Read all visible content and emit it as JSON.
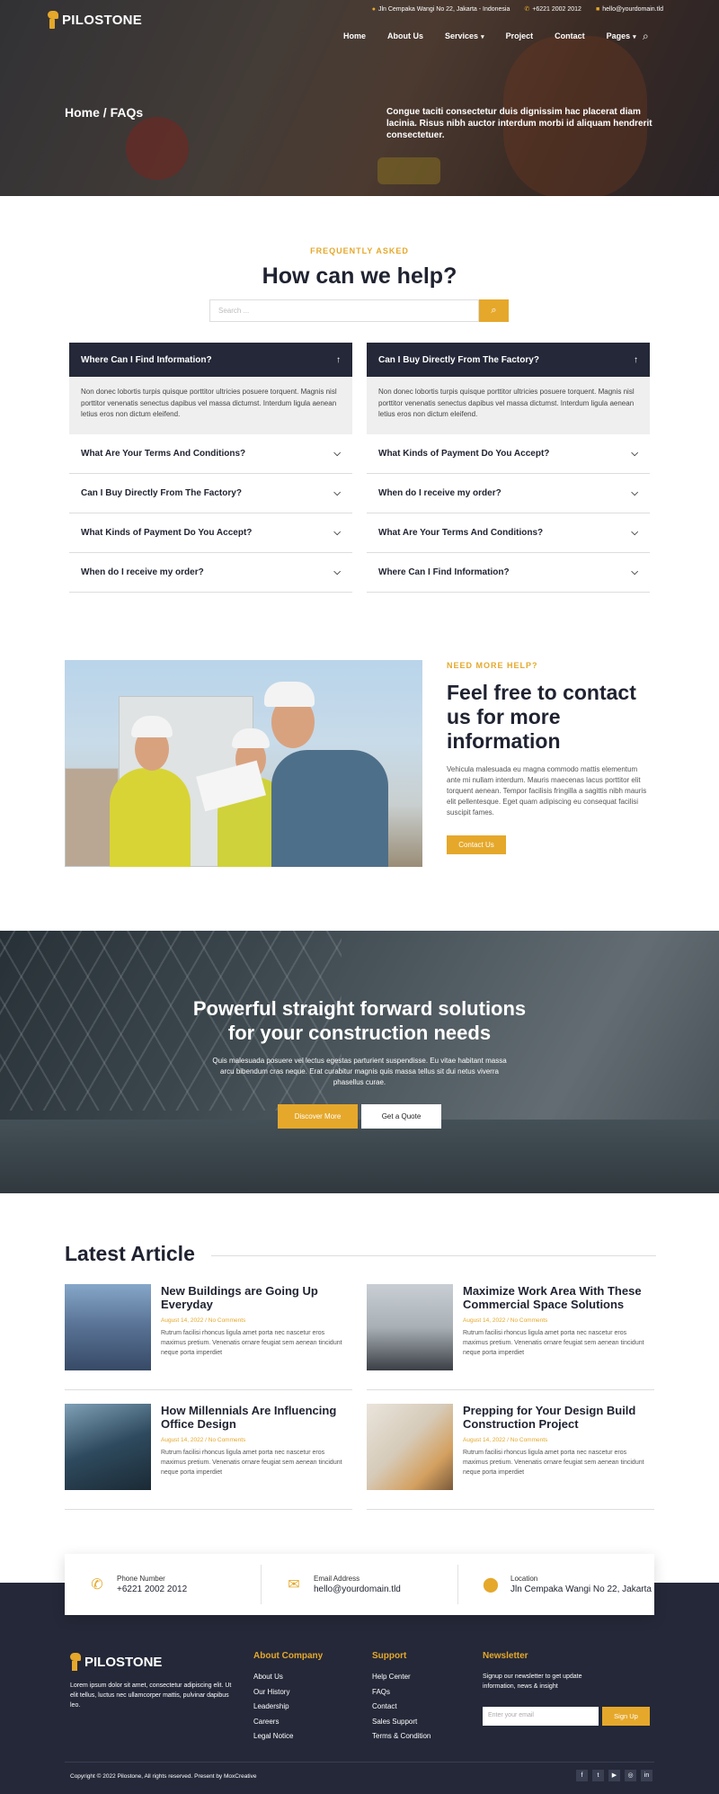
{
  "topbar": {
    "address": "Jln Cempaka Wangi No 22, Jakarta - Indonesia",
    "phone": "+6221 2002 2012",
    "email": "hello@yourdomain.tld"
  },
  "brand": {
    "name": "PILOSTONE"
  },
  "nav": [
    "Home",
    "About Us",
    "Services",
    "Project",
    "Contact",
    "Pages"
  ],
  "hero": {
    "breadcrumb": "Home / FAQs",
    "text": "Congue taciti consectetur duis dignissim hac placerat diam lacinia. Risus nibh auctor interdum morbi id aliquam hendrerit consectetuer."
  },
  "faq": {
    "eyebrow": "FREQUENTLY ASKED",
    "title": "How can we help?",
    "search_placeholder": "Search ...",
    "left": {
      "open_q": "Where Can I Find Information?",
      "answer": "Non donec lobortis turpis quisque porttitor ultricies posuere torquent. Magnis nisl porttitor venenatis senectus dapibus vel massa dictumst. Interdum ligula aenean letius eros non dictum eleifend.",
      "items": [
        "What Are Your Terms And Conditions?",
        "Can I Buy Directly From The Factory?",
        "What Kinds of Payment Do You Accept?",
        "When do I receive my order?"
      ]
    },
    "right": {
      "open_q": "Can I Buy Directly From The Factory?",
      "answer": "Non donec lobortis turpis quisque porttitor ultricies posuere torquent. Magnis nisl porttitor venenatis senectus dapibus vel massa dictumst. Interdum ligula aenean letius eros non dictum eleifend.",
      "items": [
        "What Kinds of Payment Do You Accept?",
        "When do I receive my order?",
        "What Are Your Terms And Conditions?",
        "Where Can I Find Information?"
      ]
    }
  },
  "contact": {
    "eyebrow": "NEED MORE HELP?",
    "title": "Feel free to contact us for more information",
    "text": "Vehicula malesuada eu magna commodo mattis elementum ante mi nullam interdum. Mauris maecenas lacus porttitor elit torquent aenean. Tempor facilisis fringilla a sagittis nibh mauris elit pellentesque. Eget quam adipiscing eu consequat facilisi suscipit fames.",
    "button": "Contact Us"
  },
  "cta": {
    "title_l1": "Powerful straight forward solutions",
    "title_l2": "for your construction needs",
    "text": "Quis malesuada posuere vel lectus egestas parturient suspendisse. Eu vitae habitant massa arcu bibendum cras neque. Erat curabitur magnis quis massa tellus sit dui netus viverra phasellus curae.",
    "btn_primary": "Discover More",
    "btn_secondary": "Get a Quote"
  },
  "articles": {
    "title": "Latest Article",
    "items": [
      {
        "title": "New Buildings are Going Up Everyday",
        "meta": "August 14, 2022 / No Comments",
        "excerpt": "Rutrum facilisi rhoncus ligula amet porta nec nascetur eros maximus pretium. Venenatis ornare feugiat sem aenean tincidunt neque porta imperdiet"
      },
      {
        "title": "Maximize Work Area With These Commercial Space Solutions",
        "meta": "August 14, 2022 / No Comments",
        "excerpt": "Rutrum facilisi rhoncus ligula amet porta nec nascetur eros maximus pretium. Venenatis ornare feugiat sem aenean tincidunt neque porta imperdiet"
      },
      {
        "title": "How Millennials Are Influencing Office Design",
        "meta": "August 14, 2022 / No Comments",
        "excerpt": "Rutrum facilisi rhoncus ligula amet porta nec nascetur eros maximus pretium. Venenatis ornare feugiat sem aenean tincidunt neque porta imperdiet"
      },
      {
        "title": "Prepping for Your Design Build Construction Project",
        "meta": "August 14, 2022 / No Comments",
        "excerpt": "Rutrum facilisi rhoncus ligula amet porta nec nascetur eros maximus pretium. Venenatis ornare feugiat sem aenean tincidunt neque porta imperdiet"
      }
    ]
  },
  "info": {
    "phone_label": "Phone Number",
    "phone": "+6221 2002 2012",
    "email_label": "Email Address",
    "email": "hello@yourdomain.tld",
    "location_label": "Location",
    "location": "Jln Cempaka Wangi No 22, Jakarta"
  },
  "footer": {
    "about": "Lorem ipsum dolor sit amet, consectetur adipiscing elit. Ut elit tellus, luctus nec ullamcorper mattis, pulvinar dapibus leo.",
    "company_title": "About Company",
    "company_links": [
      "About Us",
      "Our History",
      "Leadership",
      "Careers",
      "Legal Notice"
    ],
    "support_title": "Support",
    "support_links": [
      "Help Center",
      "FAQs",
      "Contact",
      "Sales Support",
      "Terms & Condition"
    ],
    "newsletter_title": "Newsletter",
    "newsletter_text": "Signup our newsletter to get update information, news & insight",
    "email_placeholder": "Enter your email",
    "signup": "Sign Up",
    "copyright": "Copyright © 2022 Pilostone, All rights reserved. Present by MoxCreative",
    "social": [
      "f",
      "t",
      "yt",
      "ig",
      "in"
    ]
  },
  "colors": {
    "accent": "#e5a82b",
    "dark": "#242838"
  }
}
